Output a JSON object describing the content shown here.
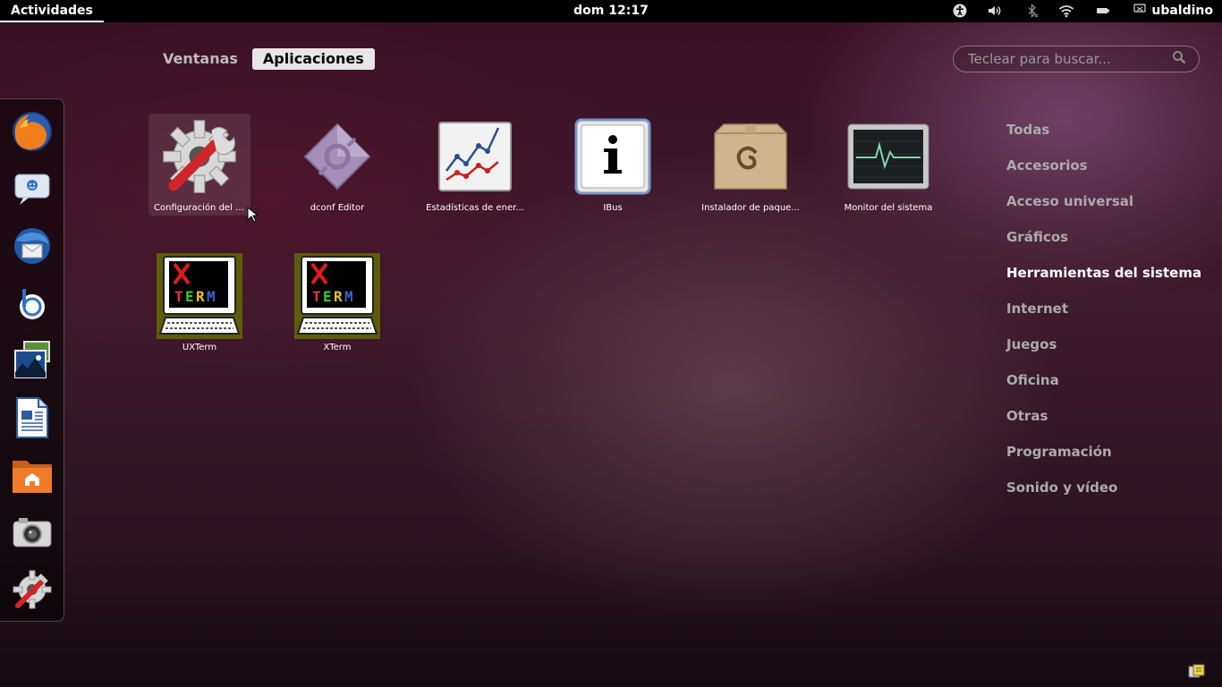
{
  "top_panel": {
    "activities_label": "Actividades",
    "clock": "dom 12:17",
    "user_name": "ubaldino",
    "tray_icons": [
      "accessibility-icon",
      "volume-icon",
      "bluetooth-icon",
      "wifi-icon",
      "battery-icon"
    ]
  },
  "overview": {
    "tabs": [
      {
        "label": "Ventanas",
        "active": false
      },
      {
        "label": "Aplicaciones",
        "active": true
      }
    ],
    "search": {
      "placeholder": "Teclear para buscar..."
    }
  },
  "dash": {
    "favorites": [
      "firefox-icon",
      "empathy-chat-icon",
      "thunderbird-mail-icon",
      "banshee-music-icon",
      "shotwell-photos-icon",
      "libreoffice-writer-icon",
      "home-folder-icon",
      "camera-icon",
      "system-settings-icon"
    ]
  },
  "apps": [
    {
      "label": "Configuración del si...",
      "icon": "system-settings-icon"
    },
    {
      "label": "dconf Editor",
      "icon": "dconf-editor-icon"
    },
    {
      "label": "Estadísticas de ener...",
      "icon": "power-statistics-icon"
    },
    {
      "label": "IBus",
      "icon": "ibus-info-icon"
    },
    {
      "label": "Instalador de paque...",
      "icon": "package-installer-icon"
    },
    {
      "label": "Monitor del sistema",
      "icon": "system-monitor-icon"
    },
    {
      "label": "UXTerm",
      "icon": "uxterm-icon"
    },
    {
      "label": "XTerm",
      "icon": "xterm-icon"
    }
  ],
  "categories": [
    {
      "label": "Todas",
      "active": false
    },
    {
      "label": "Accesorios",
      "active": false
    },
    {
      "label": "Acceso universal",
      "active": false
    },
    {
      "label": "Gráficos",
      "active": false
    },
    {
      "label": "Herramientas del sistema",
      "active": true
    },
    {
      "label": "Internet",
      "active": false
    },
    {
      "label": "Juegos",
      "active": false
    },
    {
      "label": "Oficina",
      "active": false
    },
    {
      "label": "Otras",
      "active": false
    },
    {
      "label": "Programación",
      "active": false
    },
    {
      "label": "Sonido y vídeo",
      "active": false
    }
  ]
}
